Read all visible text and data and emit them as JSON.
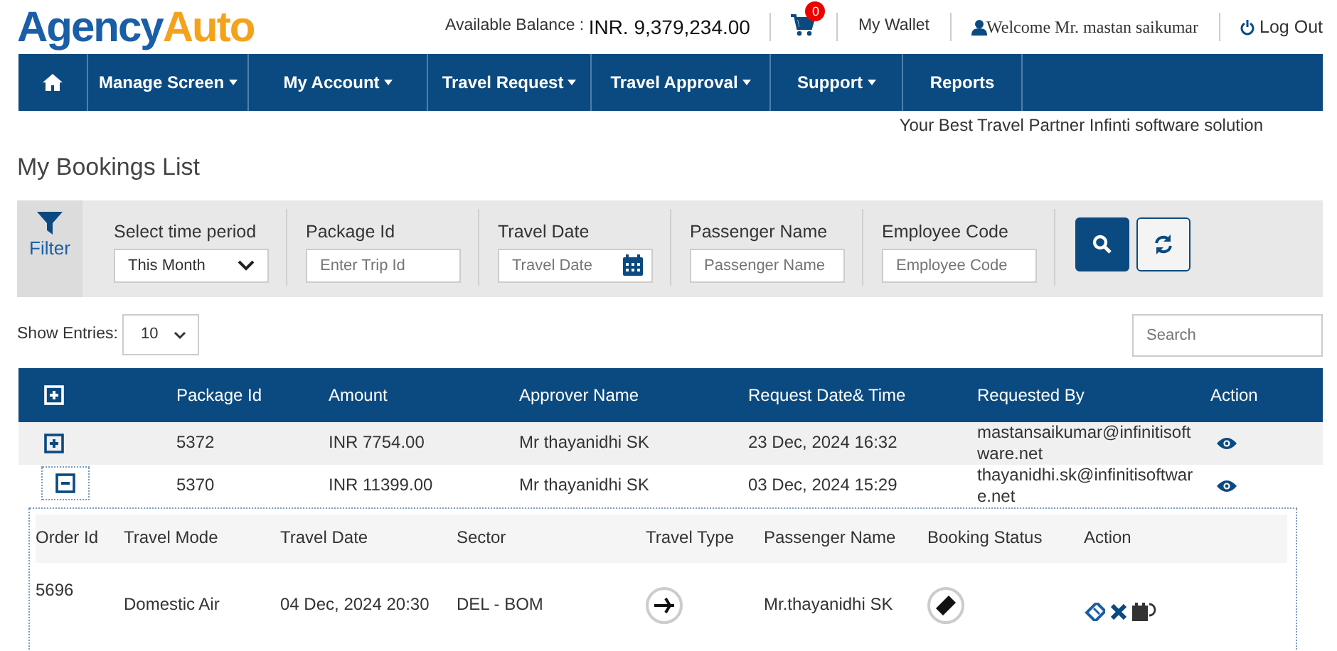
{
  "logo": {
    "part_1": "Agency",
    "part_2": "Auto"
  },
  "header": {
    "balance_label": "Available Balance :",
    "balance": "INR. 9,379,234.00",
    "cart_count": "0",
    "wallet": "My Wallet",
    "welcome": "Welcome Mr. mastan saikumar",
    "logout": "Log Out"
  },
  "nav": [
    {
      "label": "Manage Screen",
      "dropdown": true
    },
    {
      "label": "My Account",
      "dropdown": true
    },
    {
      "label": "Travel Request",
      "dropdown": true
    },
    {
      "label": "Travel Approval",
      "dropdown": true
    },
    {
      "label": "Support",
      "dropdown": true
    },
    {
      "label": "Reports",
      "dropdown": false
    }
  ],
  "tagline": "Your Best Travel Partner Infinti software solution",
  "page_title": "My Bookings List",
  "filter": {
    "label": "Filter",
    "fields": [
      {
        "kind": "select",
        "label": "Select time period",
        "value": "This Month"
      },
      {
        "kind": "text",
        "label": "Package Id",
        "placeholder": "Enter Trip Id"
      },
      {
        "kind": "date",
        "label": "Travel Date",
        "placeholder": "Travel Date"
      },
      {
        "kind": "text",
        "label": "Passenger Name",
        "placeholder": "Passenger Name"
      },
      {
        "kind": "text",
        "label": "Employee Code",
        "placeholder": "Employee Code"
      }
    ]
  },
  "entries": {
    "label": "Show Entries:",
    "value": "10"
  },
  "search": {
    "placeholder": "Search"
  },
  "table": {
    "columns": [
      "Package Id",
      "Amount",
      "Approver Name",
      "Request Date& Time",
      "Requested By",
      "Action"
    ],
    "rows": [
      {
        "expanded": false,
        "package_id": "5372",
        "amount": "INR 7754.00",
        "approver": "Mr thayanidhi SK",
        "request_date": "23 Dec, 2024 16:32",
        "requested_by": "mastansaikumar@infinitisoftware.net"
      },
      {
        "expanded": true,
        "package_id": "5370",
        "amount": "INR 11399.00",
        "approver": "Mr thayanidhi SK",
        "request_date": "03 Dec, 2024 15:29",
        "requested_by": "thayanidhi.sk@infinitisoftware.net",
        "details": {
          "columns": [
            "Order Id",
            "Travel Mode",
            "Travel Date",
            "Sector",
            "Travel Type",
            "Passenger Name",
            "Booking Status",
            "Action"
          ],
          "rows": [
            {
              "order_id": "5696",
              "travel_mode": "Domestic Air",
              "travel_date": "04 Dec, 2024 20:30",
              "sector": "DEL - BOM",
              "passenger_name": "Mr.thayanidhi SK"
            }
          ]
        }
      }
    ]
  }
}
